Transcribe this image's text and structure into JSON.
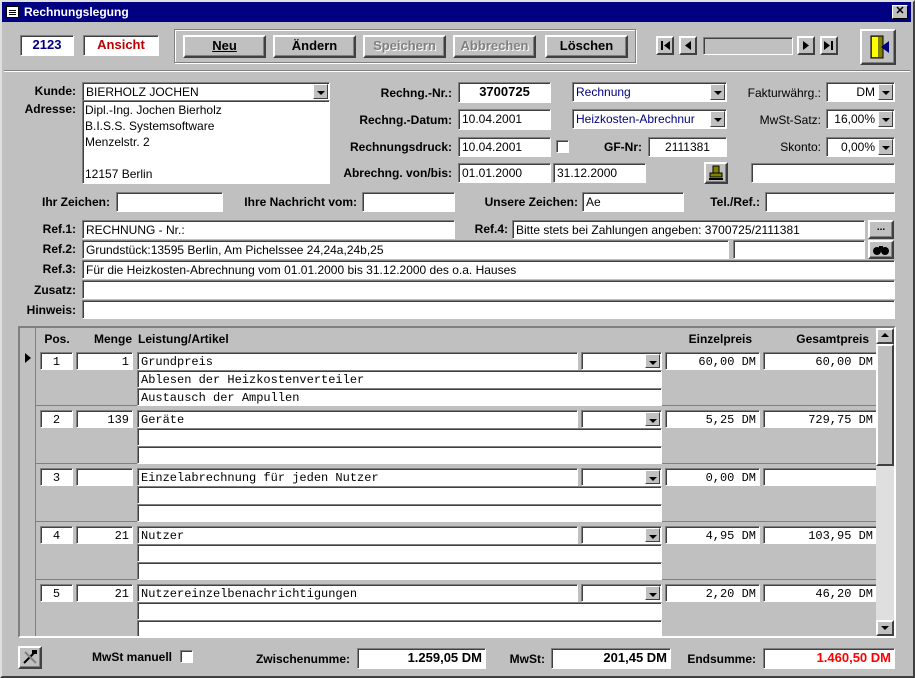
{
  "window": {
    "title": "Rechnungslegung"
  },
  "toolbar": {
    "record_id": "2123",
    "mode": "Ansicht",
    "buttons": {
      "new": "Neu",
      "edit": "Ändern",
      "save": "Speichern",
      "cancel": "Abbrechen",
      "delete": "Löschen"
    }
  },
  "header": {
    "kunde_label": "Kunde:",
    "kunde": "BIERHOLZ JOCHEN",
    "adresse_label": "Adresse:",
    "adresse_lines": [
      "Dipl.-Ing. Jochen Bierholz",
      "B.I.S.S. Systemsoftware",
      "Menzelstr. 2",
      "",
      "12157 Berlin"
    ],
    "rechng_nr_label": "Rechng.-Nr.:",
    "rechng_nr": "3700725",
    "rechng_datum_label": "Rechng.-Datum:",
    "rechng_datum": "10.04.2001",
    "rechnungsdruck_label": "Rechnungsdruck:",
    "rechnungsdruck": "10.04.2001",
    "abrechng_label": "Abrechng. von/bis:",
    "abrechng_von": "01.01.2000",
    "abrechng_bis": "31.12.2000",
    "doc_type": "Rechnung",
    "category": "Heizkosten-Abrechnur",
    "gf_nr_label": "GF-Nr:",
    "gf_nr": "2111381",
    "fakturawaehrung_label": "Fakturwährg.:",
    "fakturawaehrung": "DM",
    "mwst_satz_label": "MwSt-Satz:",
    "mwst_satz": "16,00%",
    "skonto_label": "Skonto:",
    "skonto": "0,00%",
    "ihr_zeichen_label": "Ihr Zeichen:",
    "ihr_zeichen": "",
    "ihre_nachricht_label": "Ihre Nachricht vom:",
    "ihre_nachricht": "",
    "unsere_zeichen_label": "Unsere Zeichen:",
    "unsere_zeichen": "Ae",
    "tel_ref_label": "Tel./Ref.:",
    "tel_ref": "",
    "ref1_label": "Ref.1:",
    "ref1": "RECHNUNG - Nr.:",
    "ref4_label": "Ref.4:",
    "ref4": "Bitte stets bei Zahlungen angeben: 3700725/2111381",
    "ref2_label": "Ref.2:",
    "ref2": "Grundstück:13595 Berlin, Am Pichelssee 24,24a,24b,25",
    "ref3_label": "Ref.3:",
    "ref3": "Für die Heizkosten-Abrechnung vom 01.01.2000 bis 31.12.2000 des o.a. Hauses",
    "zusatz_label": "Zusatz:",
    "zusatz": "",
    "hinweis_label": "Hinweis:",
    "hinweis": ""
  },
  "table": {
    "columns": {
      "pos": "Pos.",
      "menge": "Menge",
      "leistung": "Leistung/Artikel",
      "einzelpreis": "Einzelpreis",
      "gesamtpreis": "Gesamtpreis"
    },
    "rows": [
      {
        "pos": "1",
        "menge": "1",
        "text1": "Grundpreis",
        "text2": "Ablesen der Heizkostenverteiler",
        "text3": "Austausch der Ampullen",
        "einzelpreis": "60,00 DM",
        "gesamtpreis": "60,00 DM"
      },
      {
        "pos": "2",
        "menge": "139",
        "text1": "Geräte",
        "text2": "",
        "text3": "",
        "einzelpreis": "5,25 DM",
        "gesamtpreis": "729,75 DM"
      },
      {
        "pos": "3",
        "menge": "",
        "text1": "Einzelabrechnung für jeden Nutzer",
        "text2": "",
        "text3": "",
        "einzelpreis": "0,00 DM",
        "gesamtpreis": ""
      },
      {
        "pos": "4",
        "menge": "21",
        "text1": "Nutzer",
        "text2": "",
        "text3": "",
        "einzelpreis": "4,95 DM",
        "gesamtpreis": "103,95 DM"
      },
      {
        "pos": "5",
        "menge": "21",
        "text1": "Nutzereinzelbenachrichtigungen",
        "text2": "",
        "text3": "",
        "einzelpreis": "2,20 DM",
        "gesamtpreis": "46,20 DM"
      }
    ]
  },
  "footer": {
    "mwst_manuell_label": "MwSt manuell",
    "zwischensumme_label": "Zwischenumme:",
    "zwischensumme": "1.259,05 DM",
    "mwst_label": "MwSt:",
    "mwst": "201,45 DM",
    "endsumme_label": "Endsumme:",
    "endsumme": "1.460,50 DM"
  },
  "colors": {
    "title_bar": "#000080",
    "mode_text": "#c00000",
    "id_text": "#000080",
    "combo_text": "#000080",
    "endsumme_text": "#ff0000"
  }
}
